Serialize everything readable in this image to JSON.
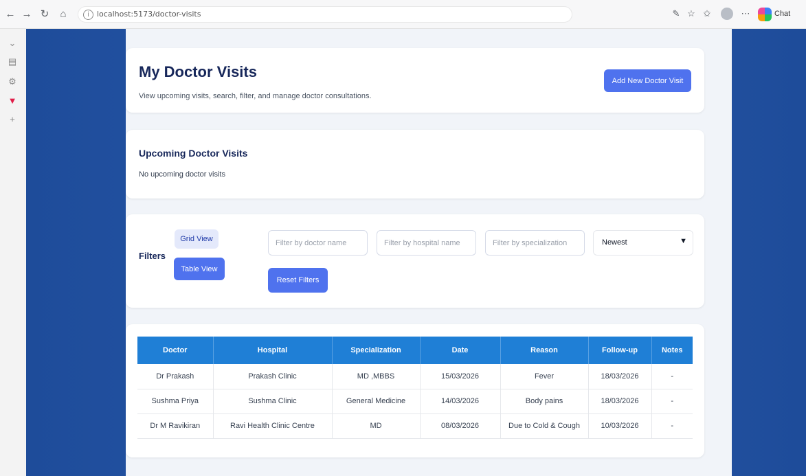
{
  "browser": {
    "url": "localhost:5173/doctor-visits",
    "copilot_label": "Chat"
  },
  "header": {
    "title": "My Doctor Visits",
    "subtitle": "View upcoming visits, search, filter, and manage doctor consultations.",
    "add_button": "Add New Doctor Visit"
  },
  "upcoming": {
    "title": "Upcoming Doctor Visits",
    "empty_text": "No upcoming doctor visits"
  },
  "filters": {
    "label": "Filters",
    "grid_view": "Grid View",
    "table_view": "Table View",
    "doctor_placeholder": "Filter by doctor name",
    "hospital_placeholder": "Filter by hospital name",
    "specialization_placeholder": "Filter by specialization",
    "sort_value": "Newest",
    "reset_button": "Reset Filters"
  },
  "table": {
    "columns": [
      "Doctor",
      "Hospital",
      "Specialization",
      "Date",
      "Reason",
      "Follow-up",
      "Notes"
    ],
    "rows": [
      [
        "Dr Prakash",
        "Prakash Clinic",
        "MD ,MBBS",
        "15/03/2026",
        "Fever",
        "18/03/2026",
        "-"
      ],
      [
        "Sushma Priya",
        "Sushma Clinic",
        "General Medicine",
        "14/03/2026",
        "Body pains",
        "18/03/2026",
        "-"
      ],
      [
        "Dr M Ravikiran",
        "Ravi Health Clinic Centre",
        "MD",
        "08/03/2026",
        "Due to Cold & Cough",
        "10/03/2026",
        "-"
      ]
    ]
  }
}
